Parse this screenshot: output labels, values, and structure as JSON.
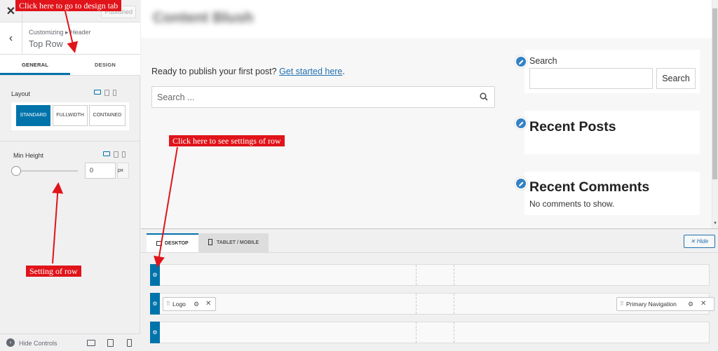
{
  "panel": {
    "published_label": "Published",
    "breadcrumb": "Customizing ▸ Header",
    "section_title": "Top Row",
    "tabs": [
      "GENERAL",
      "DESIGN"
    ],
    "layout_label": "Layout",
    "layout_options": [
      "STANDARD",
      "FULLWIDTH",
      "CONTAINED"
    ],
    "layout_selected": "STANDARD",
    "min_height_label": "Min Height",
    "min_height_value": "0",
    "min_height_unit": "px",
    "hide_controls_label": "Hide Controls"
  },
  "preview": {
    "site_title": "Content Blush",
    "intro_text": "Ready to publish your first post?",
    "intro_link": "Get started here",
    "intro_end": ".",
    "search_placeholder": "Search ...",
    "search_widget_label": "Search",
    "search_button": "Search",
    "recent_posts_title": "Recent Posts",
    "recent_comments_title": "Recent Comments",
    "recent_comments_text": "No comments to show."
  },
  "builder": {
    "tabs": [
      "DESKTOP",
      "TABLET / MOBILE"
    ],
    "hide_label": "Hide",
    "items": {
      "logo": "Logo",
      "primary_nav": "Primary Navigation"
    }
  },
  "annotations": {
    "design_tab": "Click here to go to design tab",
    "row_settings": "Click here to see settings of row",
    "setting_of_row": "Setting of row"
  },
  "colors": {
    "accent": "#0073aa",
    "annotation": "#e0141a",
    "link": "#2271b1"
  }
}
